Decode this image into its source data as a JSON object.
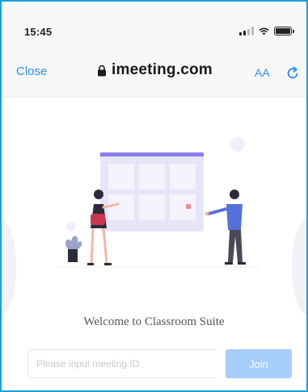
{
  "status_bar": {
    "time": "15:45"
  },
  "browser": {
    "close_label": "Close",
    "domain": "imeeting.com",
    "text_size_label": "AA"
  },
  "icons": {
    "signal": "cellular-signal-icon",
    "wifi": "wifi-icon",
    "battery": "battery-icon",
    "lock": "lock-icon",
    "reload": "reload-icon"
  },
  "page": {
    "welcome_text": "Welcome to Classroom Suite",
    "meeting_input": {
      "placeholder": "Please input meeting ID",
      "value": ""
    },
    "join_label": "Join"
  },
  "colors": {
    "frame": "#1aa0d8",
    "accent": "#2d8ef1",
    "button_disabled": "#a7cdfa",
    "illustration_board": "#e6e4f7",
    "illustration_accent": "#8b7ee8"
  }
}
